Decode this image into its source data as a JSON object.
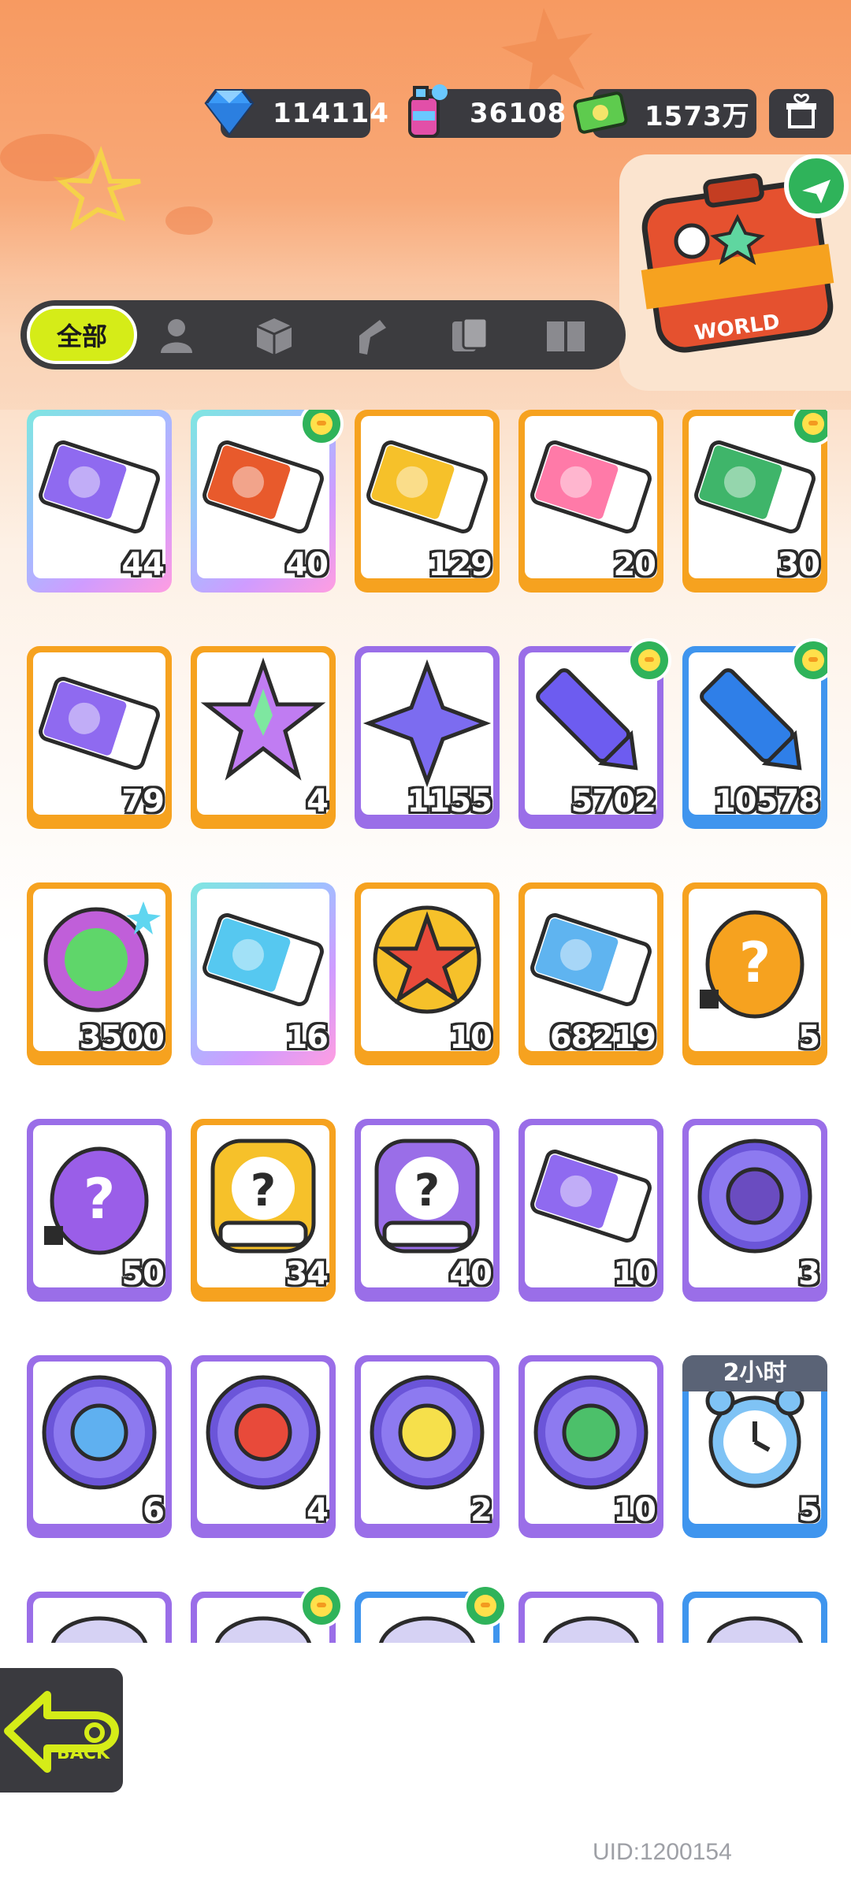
{
  "currency": [
    {
      "name": "diamond-icon",
      "value": "114114",
      "color": "#49a4ff"
    },
    {
      "name": "spray-can-icon",
      "value": "36108",
      "color": "#6ac8ff"
    },
    {
      "name": "cash-icon",
      "value": "1573万",
      "color": "#5ecb4e"
    }
  ],
  "tabs": {
    "all_label": "全部",
    "icons": [
      "person-icon",
      "box-icon",
      "spray-gun-icon",
      "cards-icon",
      "book-icon"
    ]
  },
  "suitcase": {
    "label": "WORLD"
  },
  "items": [
    {
      "qty": "44",
      "frame": "rainbow",
      "icon": "purple-ticket-icon",
      "badge": false
    },
    {
      "qty": "40",
      "frame": "rainbow",
      "icon": "lion-dance-ticket-icon",
      "badge": true
    },
    {
      "qty": "129",
      "frame": "orange",
      "icon": "gold-ticket-icon",
      "badge": false
    },
    {
      "qty": "20",
      "frame": "orange",
      "icon": "character-ticket-icon",
      "badge": false
    },
    {
      "qty": "30",
      "frame": "orange",
      "icon": "bun-ticket-icon",
      "badge": true
    },
    {
      "qty": "79",
      "frame": "orange",
      "icon": "star-ticket-icon",
      "badge": false
    },
    {
      "qty": "4",
      "frame": "orange",
      "icon": "rainbow-star-icon",
      "badge": false
    },
    {
      "qty": "1155",
      "frame": "purple",
      "icon": "purple-star-icon",
      "badge": false
    },
    {
      "qty": "5702",
      "frame": "purple",
      "icon": "purple-crayon-icon",
      "badge": true
    },
    {
      "qty": "10578",
      "frame": "blue",
      "icon": "blue-crayon-icon",
      "badge": true
    },
    {
      "qty": "3500",
      "frame": "orange",
      "icon": "cool-badge-icon",
      "badge": false
    },
    {
      "qty": "16",
      "frame": "rainbow",
      "icon": "lottery-ticket-icon",
      "badge": false
    },
    {
      "qty": "10",
      "frame": "orange",
      "icon": "star-coin-icon",
      "badge": false
    },
    {
      "qty": "68219",
      "frame": "orange",
      "icon": "season-ticket-icon",
      "badge": false
    },
    {
      "qty": "5",
      "frame": "orange",
      "icon": "mystery-egg-orange-icon",
      "badge": false
    },
    {
      "qty": "50",
      "frame": "purple",
      "icon": "mystery-egg-purple-icon",
      "badge": false
    },
    {
      "qty": "34",
      "frame": "orange",
      "icon": "mystery-deity-gold-icon",
      "badge": false
    },
    {
      "qty": "40",
      "frame": "purple",
      "icon": "mystery-deity-purple-icon",
      "badge": false
    },
    {
      "qty": "10",
      "frame": "purple",
      "icon": "travel-card-icon",
      "badge": false
    },
    {
      "qty": "3",
      "frame": "purple",
      "icon": "mpets-creature-orb-icon",
      "badge": false
    },
    {
      "qty": "6",
      "frame": "purple",
      "icon": "mpets-fish-orb-icon",
      "badge": false
    },
    {
      "qty": "4",
      "frame": "purple",
      "icon": "mpets-piranha-orb-icon",
      "badge": false
    },
    {
      "qty": "2",
      "frame": "purple",
      "icon": "mpets-yellow-orb-icon",
      "badge": false
    },
    {
      "qty": "10",
      "frame": "purple",
      "icon": "mpets-plant-orb-icon",
      "badge": false
    },
    {
      "qty": "5",
      "frame": "blue",
      "icon": "alarm-clock-icon",
      "badge": false,
      "timer": "2小时"
    },
    {
      "qty": "",
      "frame": "purple",
      "icon": "partial-item-icon",
      "badge": false
    },
    {
      "qty": "",
      "frame": "purple",
      "icon": "partial-item-icon",
      "badge": true
    },
    {
      "qty": "",
      "frame": "blue",
      "icon": "partial-item-icon",
      "badge": true
    },
    {
      "qty": "",
      "frame": "purple",
      "icon": "partial-item-icon",
      "badge": false
    },
    {
      "qty": "",
      "frame": "blue",
      "icon": "partial-item-icon",
      "badge": false
    }
  ],
  "back": {
    "label": "BACK"
  },
  "uid": "UID:1200154"
}
